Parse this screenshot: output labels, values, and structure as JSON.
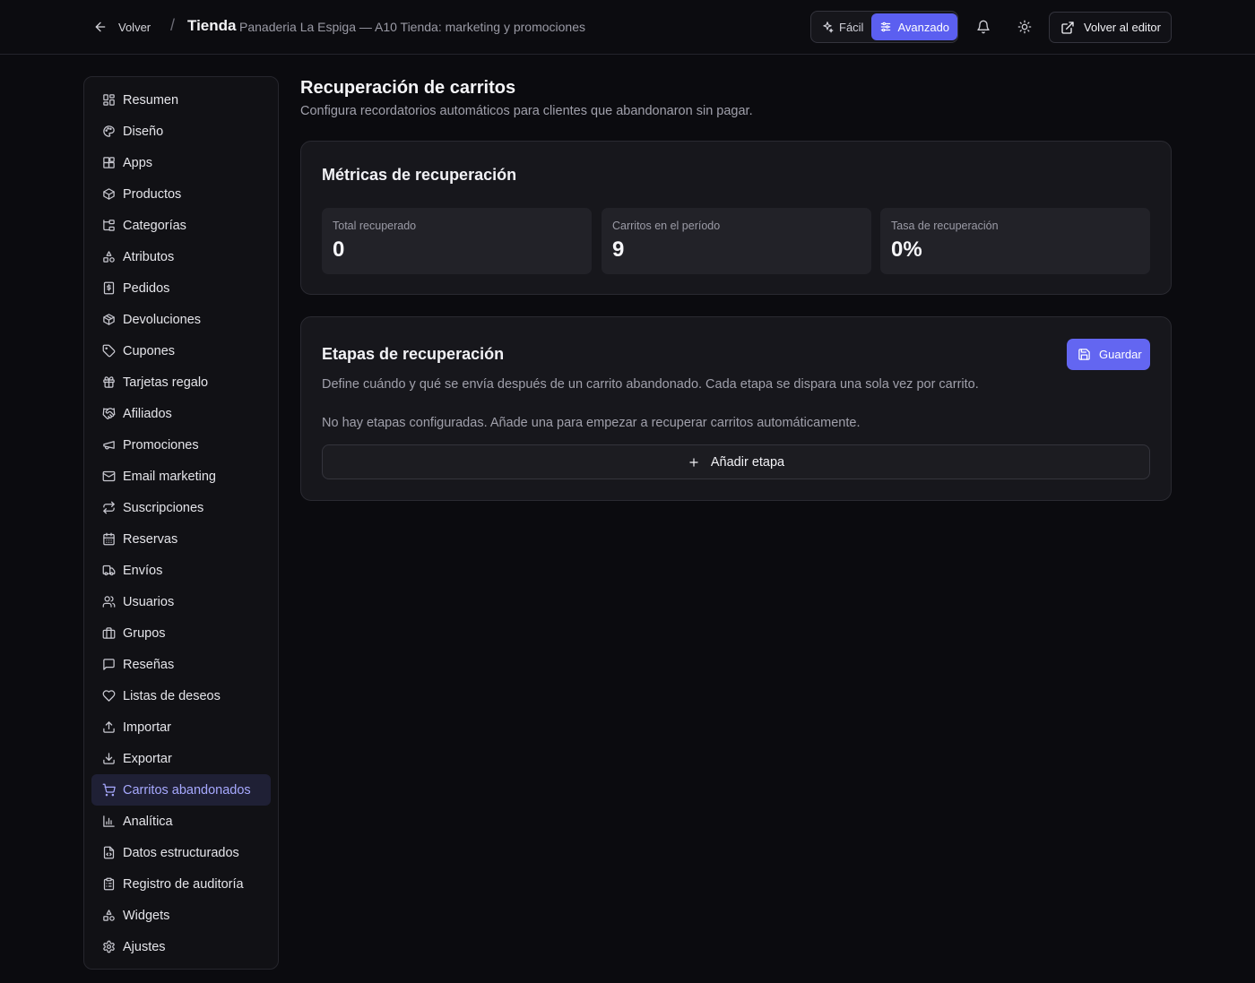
{
  "header": {
    "back_label": "Volver",
    "separator": "/",
    "title": "Tienda",
    "subtitle": "Panaderia La Espiga — A10 Tienda: marketing y promociones",
    "mode_easy": "Fácil",
    "mode_advanced": "Avanzado",
    "active_mode": "Avanzado",
    "editor_label": "Volver al editor"
  },
  "sidebar": {
    "active": "Carritos abandonados",
    "items": [
      {
        "label": "Resumen",
        "icon": "dashboard-icon"
      },
      {
        "label": "Diseño",
        "icon": "palette-icon"
      },
      {
        "label": "Apps",
        "icon": "apps-icon"
      },
      {
        "label": "Productos",
        "icon": "package-icon"
      },
      {
        "label": "Categorías",
        "icon": "folder-tree-icon"
      },
      {
        "label": "Atributos",
        "icon": "shapes-icon"
      },
      {
        "label": "Pedidos",
        "icon": "receipt-icon"
      },
      {
        "label": "Devoluciones",
        "icon": "package-return-icon"
      },
      {
        "label": "Cupones",
        "icon": "tag-icon"
      },
      {
        "label": "Tarjetas regalo",
        "icon": "gift-icon"
      },
      {
        "label": "Afiliados",
        "icon": "handshake-icon"
      },
      {
        "label": "Promociones",
        "icon": "megaphone-icon"
      },
      {
        "label": "Email marketing",
        "icon": "mail-icon"
      },
      {
        "label": "Suscripciones",
        "icon": "repeat-icon"
      },
      {
        "label": "Reservas",
        "icon": "calendar-icon"
      },
      {
        "label": "Envíos",
        "icon": "truck-icon"
      },
      {
        "label": "Usuarios",
        "icon": "users-icon"
      },
      {
        "label": "Grupos",
        "icon": "groups-icon"
      },
      {
        "label": "Reseñas",
        "icon": "message-icon"
      },
      {
        "label": "Listas de deseos",
        "icon": "heart-icon"
      },
      {
        "label": "Importar",
        "icon": "upload-icon"
      },
      {
        "label": "Exportar",
        "icon": "download-icon"
      },
      {
        "label": "Carritos abandonados",
        "icon": "cart-icon"
      },
      {
        "label": "Analítica",
        "icon": "bar-chart-icon"
      },
      {
        "label": "Datos estructurados",
        "icon": "file-code-icon"
      },
      {
        "label": "Registro de auditoría",
        "icon": "clipboard-icon"
      },
      {
        "label": "Widgets",
        "icon": "widgets-icon"
      },
      {
        "label": "Ajustes",
        "icon": "gear-icon"
      }
    ]
  },
  "main": {
    "title": "Recuperación de carritos",
    "description": "Configura recordatorios automáticos para clientes que abandonaron sin pagar.",
    "metrics_card": {
      "title": "Métricas de recuperación",
      "metrics": [
        {
          "label": "Total recuperado",
          "value": "0"
        },
        {
          "label": "Carritos en el período",
          "value": "9"
        },
        {
          "label": "Tasa de recuperación",
          "value": "0%"
        }
      ]
    },
    "stages_card": {
      "title": "Etapas de recuperación",
      "save_label": "Guardar",
      "description": "Define cuándo y qué se envía después de un carrito abandonado. Cada etapa se dispara una sola vez por carrito.",
      "empty_text": "No hay etapas configuradas. Añade una para empezar a recuperar carritos automáticamente.",
      "add_label": "Añadir etapa"
    }
  },
  "colors": {
    "background": "#0b0b0f",
    "card": "#17171c",
    "accent": "#6366f1",
    "active_nav_bg": "#1f2035",
    "active_nav_text": "#a7a9ff"
  }
}
